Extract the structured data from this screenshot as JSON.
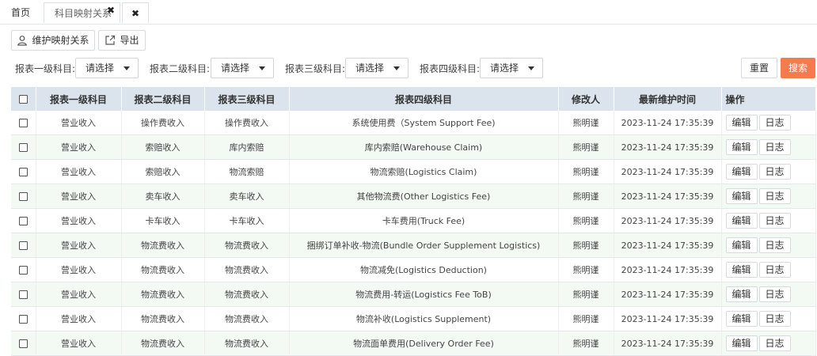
{
  "tabs": {
    "home": "首页",
    "active": "科目映射关系",
    "active_close": "✖",
    "close_all": "✖"
  },
  "toolbar": {
    "maintain_label": "维护映射关系",
    "export_label": "导出"
  },
  "filters": {
    "level1_label": "报表一级科目:",
    "level2_label": "报表二级科目:",
    "level3_label": "报表三级科目:",
    "level4_label": "报表四级科目:",
    "level1_value": "请选择",
    "level2_value": "请选择",
    "level3_value": "请选择",
    "level4_value": "请选择",
    "reset_label": "重置",
    "search_label": "搜索"
  },
  "table": {
    "headers": [
      "报表一级科目",
      "报表二级科目",
      "报表三级科目",
      "报表四级科目",
      "修改人",
      "最新维护时间",
      "操作"
    ],
    "edit_label": "编辑",
    "log_label": "日志",
    "rows": [
      {
        "l1": "营业收入",
        "l2": "操作费收入",
        "l3": "操作费收入",
        "l4": "系统使用费（System Support Fee)",
        "modifier": "熊明谨",
        "time": "2023-11-24 17:35:39"
      },
      {
        "l1": "营业收入",
        "l2": "索赔收入",
        "l3": "库内索赔",
        "l4": "库内索赔(Warehouse Claim)",
        "modifier": "熊明谨",
        "time": "2023-11-24 17:35:39"
      },
      {
        "l1": "营业收入",
        "l2": "索赔收入",
        "l3": "物流索赔",
        "l4": "物流索赔(Logistics Claim)",
        "modifier": "熊明谨",
        "time": "2023-11-24 17:35:39"
      },
      {
        "l1": "营业收入",
        "l2": "卖车收入",
        "l3": "卖车收入",
        "l4": "其他物流费(Other Logistics Fee)",
        "modifier": "熊明谨",
        "time": "2023-11-24 17:35:39"
      },
      {
        "l1": "营业收入",
        "l2": "卡车收入",
        "l3": "卡车收入",
        "l4": "卡车费用(Truck Fee)",
        "modifier": "熊明谨",
        "time": "2023-11-24 17:35:39"
      },
      {
        "l1": "营业收入",
        "l2": "物流费收入",
        "l3": "物流费收入",
        "l4": "捆绑订单补收-物流(Bundle Order Supplement Logistics)",
        "modifier": "熊明谨",
        "time": "2023-11-24 17:35:39"
      },
      {
        "l1": "营业收入",
        "l2": "物流费收入",
        "l3": "物流费收入",
        "l4": "物流减免(Logistics Deduction)",
        "modifier": "熊明谨",
        "time": "2023-11-24 17:35:39"
      },
      {
        "l1": "营业收入",
        "l2": "物流费收入",
        "l3": "物流费收入",
        "l4": "物流费用-转运(Logistics Fee ToB)",
        "modifier": "熊明谨",
        "time": "2023-11-24 17:35:39"
      },
      {
        "l1": "营业收入",
        "l2": "物流费收入",
        "l3": "物流费收入",
        "l4": "物流补收(Logistics Supplement)",
        "modifier": "熊明谨",
        "time": "2023-11-24 17:35:39"
      },
      {
        "l1": "营业收入",
        "l2": "物流费收入",
        "l3": "物流费收入",
        "l4": "物流面单费用(Delivery Order Fee)",
        "modifier": "熊明谨",
        "time": "2023-11-24 17:35:39"
      }
    ]
  },
  "colors": {
    "header_bg": "#dbe4ec",
    "row_stripe": "#f3f9f3",
    "search_button": "#f57b4e"
  },
  "icons": {
    "maintain": "user-icon",
    "export": "export-icon",
    "caret": "chevron-down-icon"
  }
}
